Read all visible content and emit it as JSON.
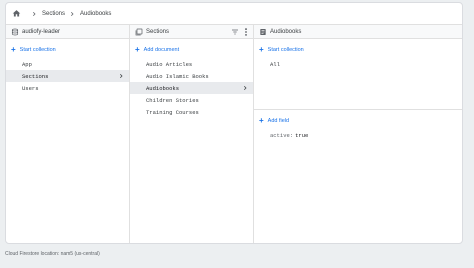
{
  "breadcrumb": {
    "items": [
      "Sections",
      "Audiobooks"
    ]
  },
  "columns": {
    "collections": {
      "title": "audiofy-leader",
      "action_label": "Start collection",
      "items": [
        {
          "label": "App"
        },
        {
          "label": "Sections"
        },
        {
          "label": "Users"
        }
      ]
    },
    "documents": {
      "title": "Sections",
      "action_label": "Add document",
      "items": [
        {
          "label": "Audio Articles"
        },
        {
          "label": "Audio Islamic Books"
        },
        {
          "label": "Audiobooks"
        },
        {
          "label": "Children Stories"
        },
        {
          "label": "Training Courses"
        }
      ]
    },
    "document": {
      "title": "Audiobooks",
      "action_label": "Start collection",
      "subcollections": [
        "All"
      ],
      "field_action_label": "Add field",
      "fields": [
        {
          "key": "active",
          "value": "true"
        }
      ]
    }
  },
  "footer": {
    "text": "Cloud Firestore location: nam5 (us-central)"
  },
  "colors": {
    "accent": "#1a73e8",
    "selected_bg": "#e8eaed",
    "page_bg": "#eceff1"
  },
  "icons": [
    "home-icon",
    "chevron-right-icon",
    "database-icon",
    "collection-icon",
    "document-icon",
    "filter-icon",
    "more-vert-icon"
  ]
}
